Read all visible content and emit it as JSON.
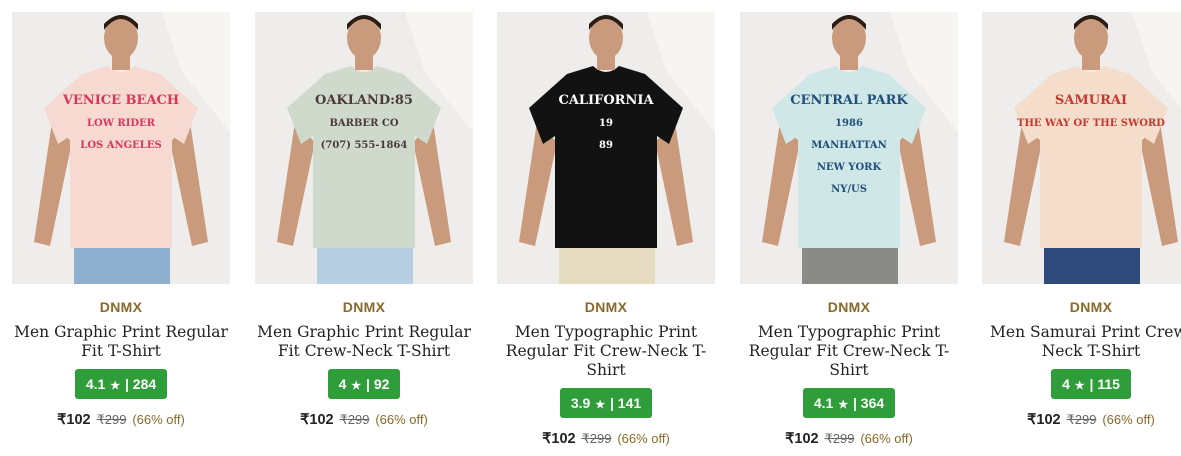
{
  "currency_symbol": "₹",
  "products": [
    {
      "brand": "DNMX",
      "title": "Men Graphic Print Regular Fit T-Shirt",
      "rating": "4.1",
      "reviews": "284",
      "price": "₹102",
      "mrp": "₹299",
      "discount": "(66% off)",
      "image": {
        "shirt_color": "#f6d9d0",
        "print_color": "#d8375a",
        "print_lines": [
          "VENICE BEACH",
          "LOW RIDER",
          "LOS ANGELES"
        ],
        "pants_color": "#8fb1cf"
      }
    },
    {
      "brand": "DNMX",
      "title": "Men Graphic Print Regular Fit Crew-Neck T-Shirt",
      "rating": "4",
      "reviews": "92",
      "price": "₹102",
      "mrp": "₹299",
      "discount": "(66% off)",
      "image": {
        "shirt_color": "#cfd9cc",
        "print_color": "#4a3a3a",
        "print_lines": [
          "OAKLAND:85",
          "BARBER CO",
          "(707) 555-1864"
        ],
        "pants_color": "#b7cfe0"
      }
    },
    {
      "brand": "DNMX",
      "title": "Men Typographic Print Regular Fit Crew-Neck T-Shirt",
      "rating": "3.9",
      "reviews": "141",
      "price": "₹102",
      "mrp": "₹299",
      "discount": "(66% off)",
      "image": {
        "shirt_color": "#121212",
        "print_color": "#ffffff",
        "print_lines": [
          "CALIFORNIA",
          "19",
          "89"
        ],
        "pants_color": "#e6dcc2"
      }
    },
    {
      "brand": "DNMX",
      "title": "Men Typographic Print Regular Fit Crew-Neck T-Shirt",
      "rating": "4.1",
      "reviews": "364",
      "price": "₹102",
      "mrp": "₹299",
      "discount": "(66% off)",
      "image": {
        "shirt_color": "#cfe7e6",
        "print_color": "#1f4f7a",
        "print_lines": [
          "CENTRAL PARK",
          "1986",
          "MANHATTAN",
          "NEW YORK",
          "NY/US"
        ],
        "pants_color": "#8a8a86"
      }
    },
    {
      "brand": "DNMX",
      "title": "Men Samurai Print Crew-Neck T-Shirt",
      "rating": "4",
      "reviews": "115",
      "price": "₹102",
      "mrp": "₹299",
      "discount": "(66% off)",
      "image": {
        "shirt_color": "#f5ddcc",
        "print_color": "#c8372b",
        "print_lines": [
          "SAMURAI",
          "THE WAY OF THE SWORD"
        ],
        "pants_color": "#2f4a7a"
      }
    }
  ]
}
